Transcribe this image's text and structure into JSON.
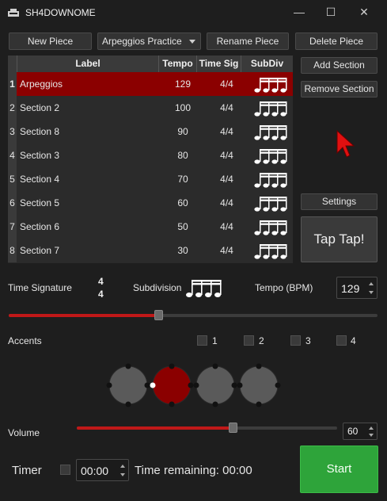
{
  "window": {
    "title": "SH4DOWNOME",
    "minimize": "—",
    "maximize": "☐",
    "close": "✕"
  },
  "toolbar": {
    "new_piece": "New Piece",
    "piece_select": "Arpeggios Practice",
    "rename_piece": "Rename Piece",
    "delete_piece": "Delete Piece"
  },
  "table": {
    "headers": [
      "Label",
      "Tempo",
      "Time Sig",
      "SubDiv"
    ],
    "rows": [
      {
        "num": "1",
        "label": "Arpeggios",
        "tempo": "129",
        "time_sig": "4/4",
        "selected": true
      },
      {
        "num": "2",
        "label": "Section 2",
        "tempo": "100",
        "time_sig": "4/4"
      },
      {
        "num": "3",
        "label": "Section 8",
        "tempo": "90",
        "time_sig": "4/4"
      },
      {
        "num": "4",
        "label": "Section 3",
        "tempo": "80",
        "time_sig": "4/4"
      },
      {
        "num": "5",
        "label": "Section 4",
        "tempo": "70",
        "time_sig": "4/4"
      },
      {
        "num": "6",
        "label": "Section 5",
        "tempo": "60",
        "time_sig": "4/4"
      },
      {
        "num": "7",
        "label": "Section 6",
        "tempo": "50",
        "time_sig": "4/4"
      },
      {
        "num": "8",
        "label": "Section 7",
        "tempo": "30",
        "time_sig": "4/4"
      }
    ]
  },
  "side": {
    "add_section": "Add Section",
    "remove_section": "Remove Section",
    "settings": "Settings",
    "tap": "Tap Tap!"
  },
  "controls": {
    "time_signature_label": "Time Signature",
    "ts_top": "4",
    "ts_bottom": "4",
    "subdivision_label": "Subdivision",
    "tempo_label": "Tempo (BPM)",
    "tempo_value": "129",
    "tempo_slider_fraction": 0.405,
    "accents_label": "Accents",
    "accent_options": [
      "1",
      "2",
      "3",
      "4"
    ],
    "accent_beats": [
      {
        "state": "normal",
        "active": false
      },
      {
        "state": "accent",
        "active": true
      },
      {
        "state": "normal",
        "active": false
      },
      {
        "state": "normal",
        "active": false
      }
    ],
    "volume_label": "Volume",
    "volume_value": "60",
    "volume_fraction": 0.6,
    "timer_label": "Timer",
    "timer_value": "00:00",
    "time_remaining": "Time remaining: 00:00",
    "start": "Start"
  },
  "colors": {
    "accent_red": "#8b0000",
    "slider_red": "#c01818",
    "start_green": "#2ea43a",
    "beat_grey": "#5a5a5a"
  },
  "icons": {
    "app": "metronome-icon",
    "subdivision": "sixteenth-notes-icon",
    "cursor": "mouse-pointer-icon"
  }
}
